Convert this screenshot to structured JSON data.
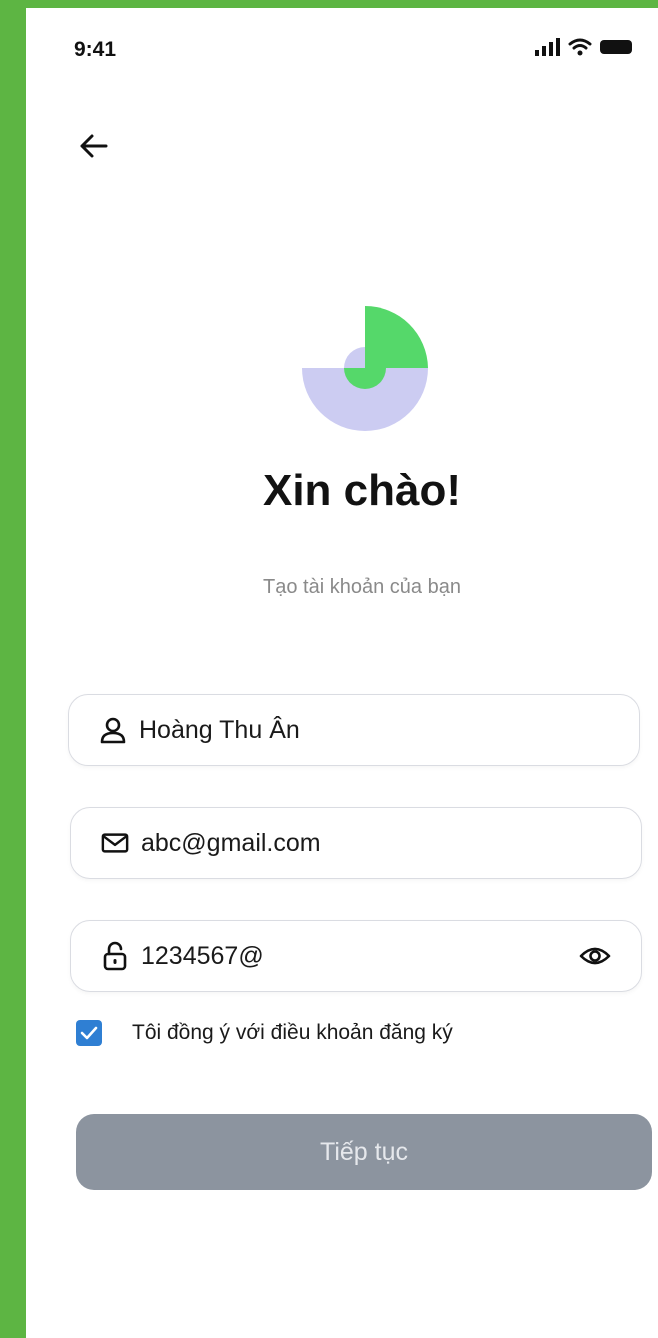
{
  "status_bar": {
    "time": "9:41"
  },
  "header": {
    "title": "Xin chào!",
    "subtitle": "Tạo tài khoản của bạn"
  },
  "form": {
    "name": {
      "value": "Hoàng Thu Ân",
      "icon": "user-icon"
    },
    "email": {
      "value": "abc@gmail.com",
      "icon": "mail-icon"
    },
    "password": {
      "value": "1234567@",
      "icon": "lock-icon",
      "toggle_icon": "eye-icon"
    },
    "terms": {
      "label": "Tôi đồng ý với điều khoản đăng ký",
      "checked": true
    },
    "submit_label": "Tiếp tục"
  },
  "colors": {
    "background": "#5db543",
    "logo_green": "#55d86a",
    "logo_lavender": "#ccccf2",
    "checkbox": "#2f7fd3",
    "button": "#8c949f"
  }
}
